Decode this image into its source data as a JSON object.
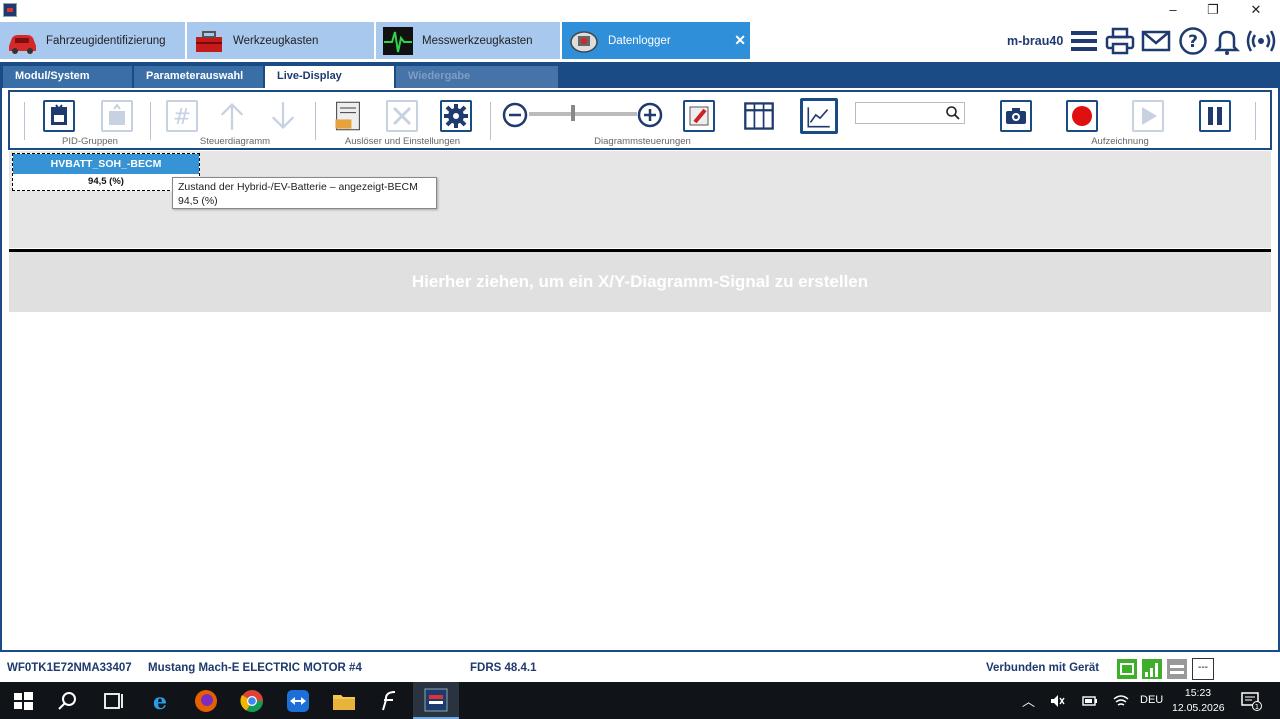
{
  "window": {
    "minimize": "–",
    "maximize": "❐",
    "close": "✕"
  },
  "main_tabs": [
    {
      "label": "Fahrzeugidentifizierung"
    },
    {
      "label": "Werkzeugkasten"
    },
    {
      "label": "Messwerkzeugkasten"
    },
    {
      "label": "Datenlogger",
      "close": "✕"
    }
  ],
  "header": {
    "user": "m-brau40"
  },
  "sub_tabs": [
    {
      "label": "Modul/System"
    },
    {
      "label": "Parameterauswahl"
    },
    {
      "label": "Live-Display"
    },
    {
      "label": "Wiedergabe"
    }
  ],
  "toolbar": {
    "groups": {
      "pid": "PID-Gruppen",
      "steuer": "Steuerdiagramm",
      "ausloeser": "Auslöser und Einstellungen",
      "diagramm": "Diagrammsteuerungen",
      "aufzeichnung": "Aufzeichnung"
    },
    "hash": "#",
    "search_value": "",
    "zoom_level": 0.4
  },
  "signal": {
    "name": "HVBATT_SOH_-BECM",
    "value": "94,5 (%)"
  },
  "tooltip": {
    "line1": "Zustand der Hybrid-/EV-Batterie – angezeigt-BECM",
    "line2": "94,5 (%)"
  },
  "xy_drop": {
    "text": "Hierher ziehen, um ein X/Y-Diagramm-Signal zu erstellen"
  },
  "status": {
    "vin": "WF0TK1E72NMA33407",
    "vehicle": "Mustang Mach-E ELECTRIC MOTOR #4",
    "version": "FDRS 48.4.1",
    "connected": "Verbunden mit Gerät",
    "extra": "---"
  },
  "taskbar": {
    "lang": "DEU",
    "time": "15:23",
    "date": "12.05.2026",
    "notification_count": "1"
  },
  "colors": {
    "brand_blue": "#1a4b85",
    "tab_active": "#2f8fd8",
    "tab_inactive": "#a8c8ee",
    "record_red": "#e01010",
    "signal_head": "#3593d6"
  }
}
